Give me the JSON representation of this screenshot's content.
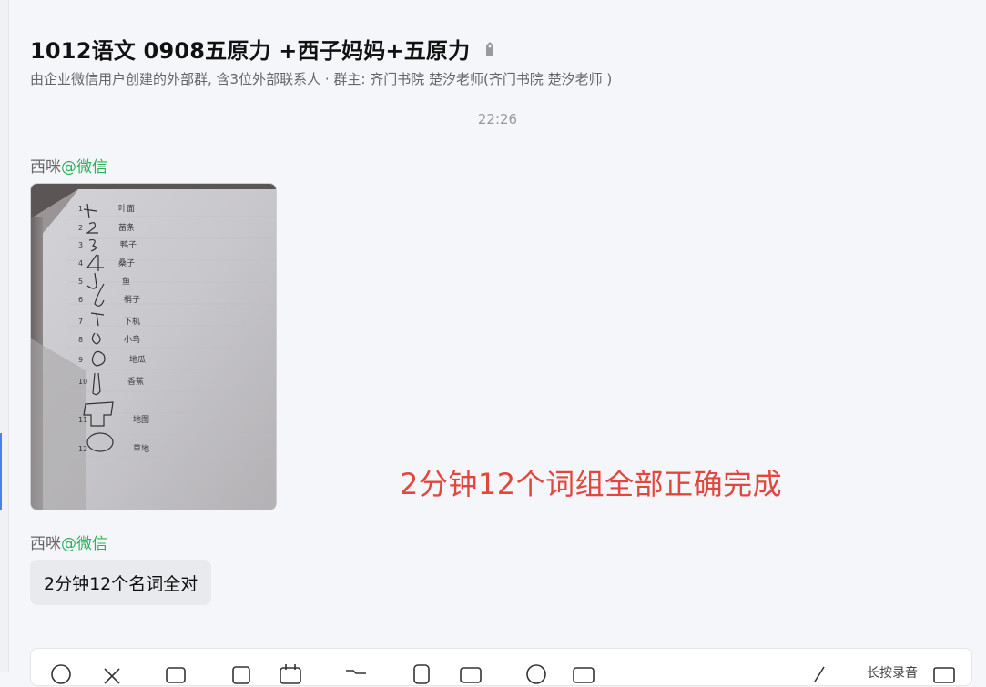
{
  "header": {
    "title": "1012语文 0908五原力 +西子妈妈+五原力",
    "subtitle": "由企业微信用户创建的外部群, 含3位外部联系人 · 群主: 齐门书院 楚汐老师(齐门书院 楚汐老师 )"
  },
  "chat": {
    "timestamp": "22:26",
    "messages": [
      {
        "sender": "西咪",
        "source": "@微信",
        "type": "image"
      },
      {
        "sender": "西咪",
        "source": "@微信",
        "type": "text",
        "text": "2分钟12个名词全对"
      }
    ],
    "overlay_text": "2分钟12个词组全部正确完成"
  },
  "photo": {
    "rows": [
      {
        "num": "1",
        "word": "叶面"
      },
      {
        "num": "2",
        "word": "苗条"
      },
      {
        "num": "3",
        "word": "鸭子"
      },
      {
        "num": "4",
        "word": "桑子"
      },
      {
        "num": "5",
        "word": "鱼"
      },
      {
        "num": "6",
        "word": "梢子"
      },
      {
        "num": "7",
        "word": "下机"
      },
      {
        "num": "8",
        "word": "小鸟"
      },
      {
        "num": "9",
        "word": "地瓜"
      },
      {
        "num": "10",
        "word": "香蕉"
      },
      {
        "num": "11",
        "word": "地图"
      },
      {
        "num": "12",
        "word": "草地"
      }
    ]
  },
  "composer": {
    "tools": [
      "emoji-icon",
      "scissors-icon",
      "folder-icon",
      "image-icon",
      "calendar-icon",
      "folder-open-icon",
      "phone-icon",
      "chat-icon",
      "clock-icon",
      "card-icon",
      "pin-icon"
    ],
    "right_label": "长按录音"
  },
  "colors": {
    "accent_green": "#2db158",
    "overlay_red": "#e2473d",
    "bubble_bg": "#e9eaed"
  }
}
